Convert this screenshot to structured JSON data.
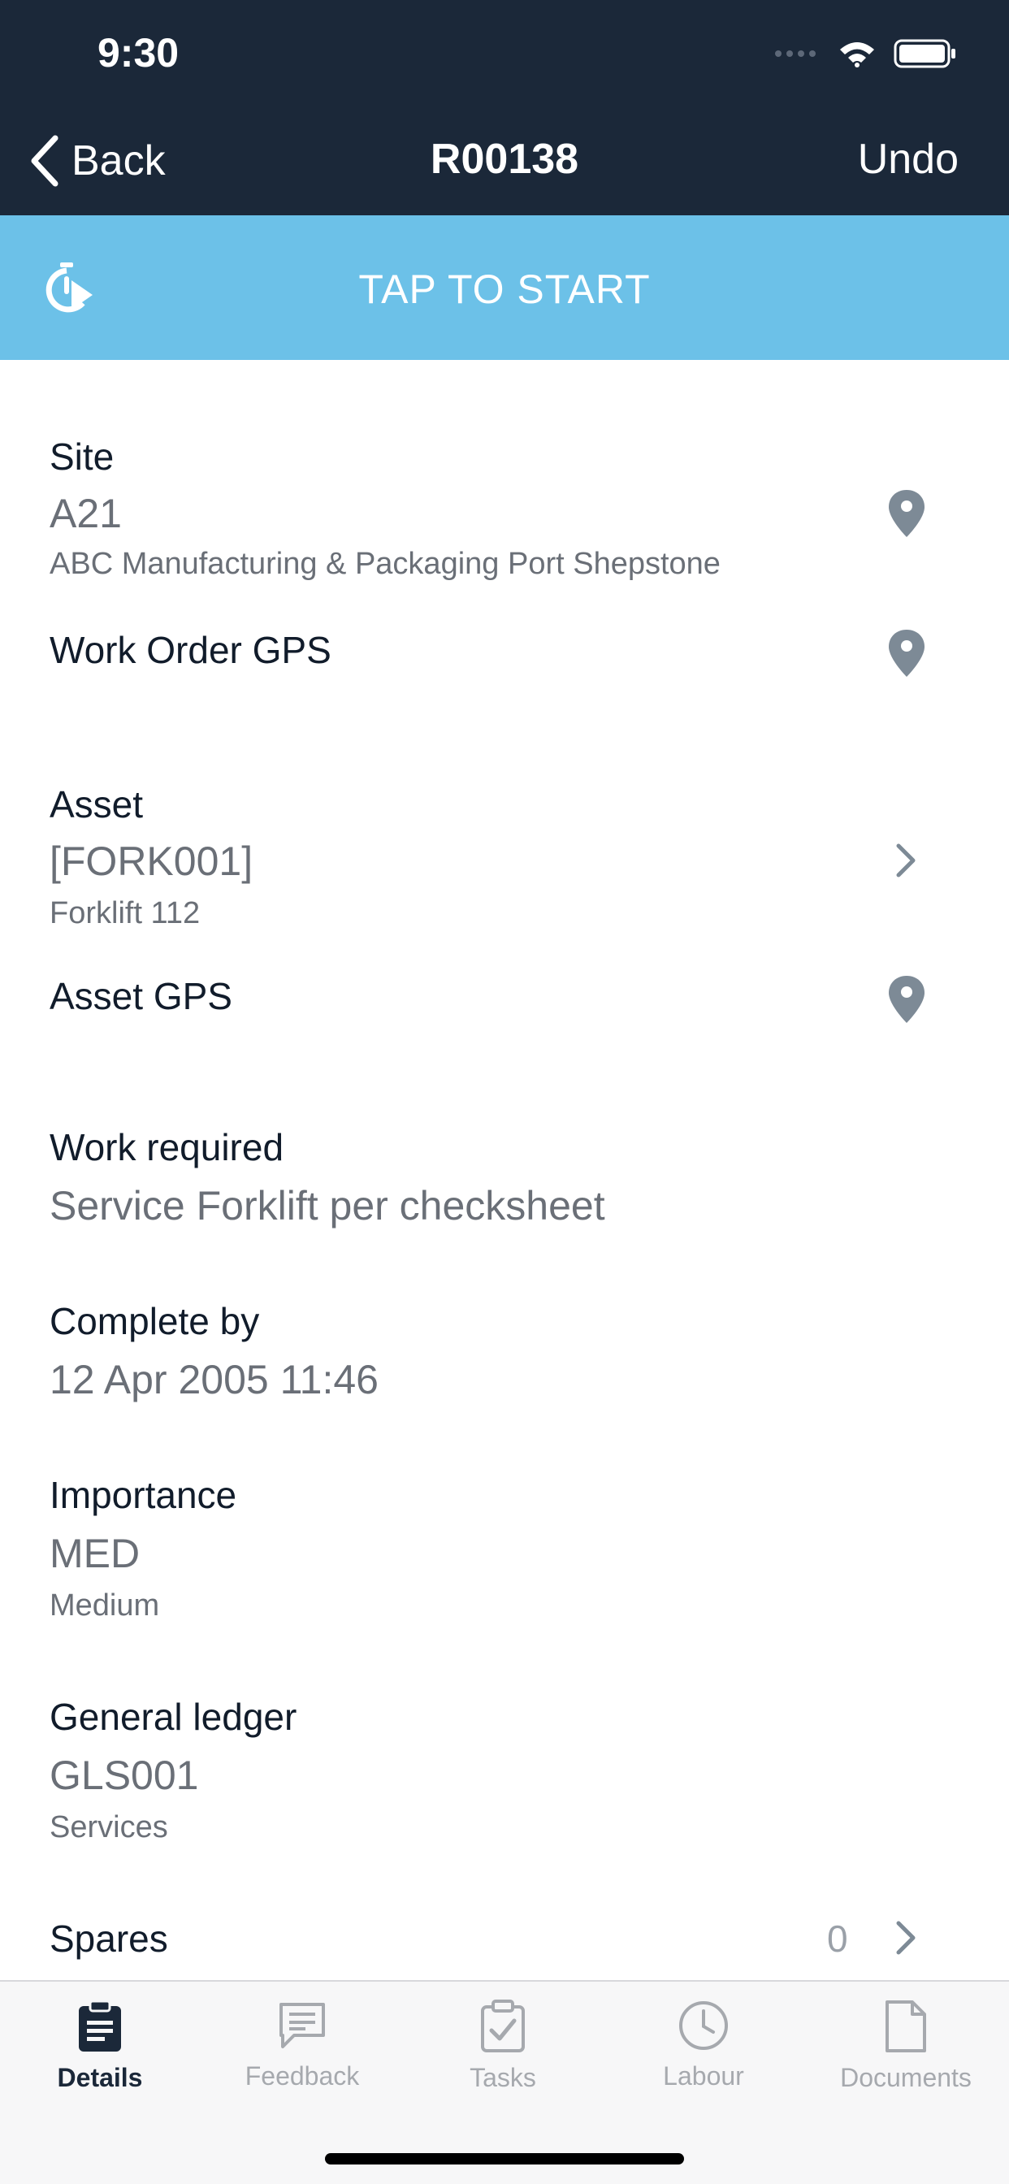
{
  "status_bar": {
    "time": "9:30",
    "icons": [
      "signal-icon",
      "wifi-icon",
      "battery-icon"
    ]
  },
  "nav": {
    "back_label": "Back",
    "title": "R00138",
    "undo_label": "Undo"
  },
  "start_bar": {
    "label": "TAP TO START",
    "icon": "timer-play-icon"
  },
  "details": {
    "site": {
      "label": "Site",
      "value": "A21",
      "sub": "ABC Manufacturing & Packaging Port Shepstone"
    },
    "work_order_gps": {
      "label": "Work Order GPS"
    },
    "asset": {
      "label": "Asset",
      "value": "[FORK001]",
      "sub": "Forklift 112"
    },
    "asset_gps": {
      "label": "Asset GPS"
    },
    "work_required": {
      "label": "Work required",
      "value": "Service Forklift per checksheet"
    },
    "complete_by": {
      "label": "Complete by",
      "value": "12 Apr 2005 11:46"
    },
    "importance": {
      "label": "Importance",
      "value": "MED",
      "sub": "Medium"
    },
    "general_ledger": {
      "label": "General ledger",
      "value": "GLS001",
      "sub": "Services"
    },
    "spares": {
      "label": "Spares",
      "count": "0"
    }
  },
  "tabs": [
    {
      "label": "Details",
      "icon": "clipboard-list-icon",
      "active": true
    },
    {
      "label": "Feedback",
      "icon": "message-icon",
      "active": false
    },
    {
      "label": "Tasks",
      "icon": "clipboard-check-icon",
      "active": false
    },
    {
      "label": "Labour",
      "icon": "clock-icon",
      "active": false
    },
    {
      "label": "Documents",
      "icon": "document-icon",
      "active": false
    }
  ],
  "colors": {
    "header": "#1b2839",
    "accent": "#6cc1e8",
    "icon_gray": "#7d8a96",
    "tab_inactive": "#a6a9ae"
  }
}
